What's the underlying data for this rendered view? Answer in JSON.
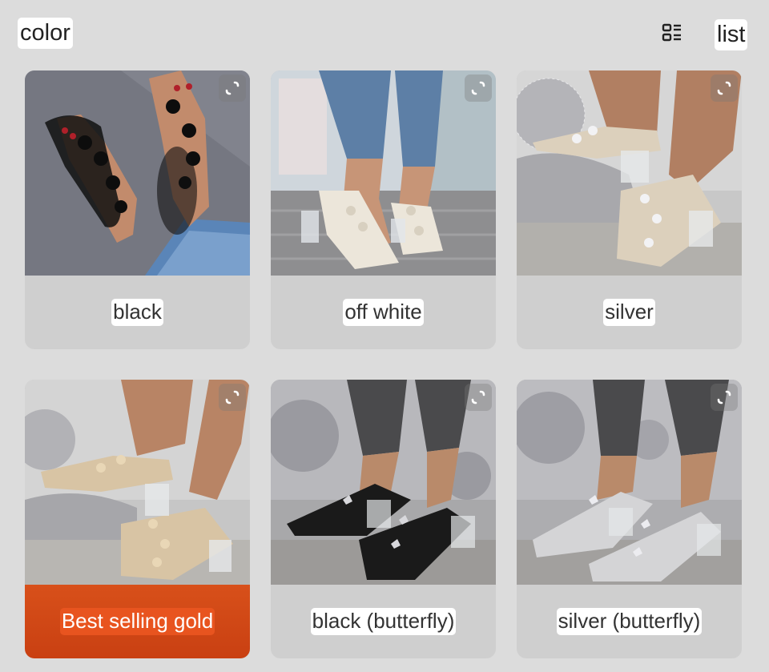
{
  "header": {
    "title": "color",
    "list_label": "list"
  },
  "options": [
    {
      "label": "black",
      "selected": false,
      "icon": "expand-icon"
    },
    {
      "label": "off white",
      "selected": false,
      "icon": "expand-icon"
    },
    {
      "label": "silver",
      "selected": false,
      "icon": "expand-icon"
    },
    {
      "label": "Best selling gold",
      "selected": true,
      "icon": "expand-icon"
    },
    {
      "label": "black (butterfly)",
      "selected": false,
      "icon": "expand-icon"
    },
    {
      "label": "silver (butterfly)",
      "selected": false,
      "icon": "expand-icon"
    }
  ],
  "colors": {
    "background": "#dcdcdc",
    "card": "#cfcfcf",
    "selected_accent": "#d8501a",
    "label_bg": "#ffffff"
  }
}
